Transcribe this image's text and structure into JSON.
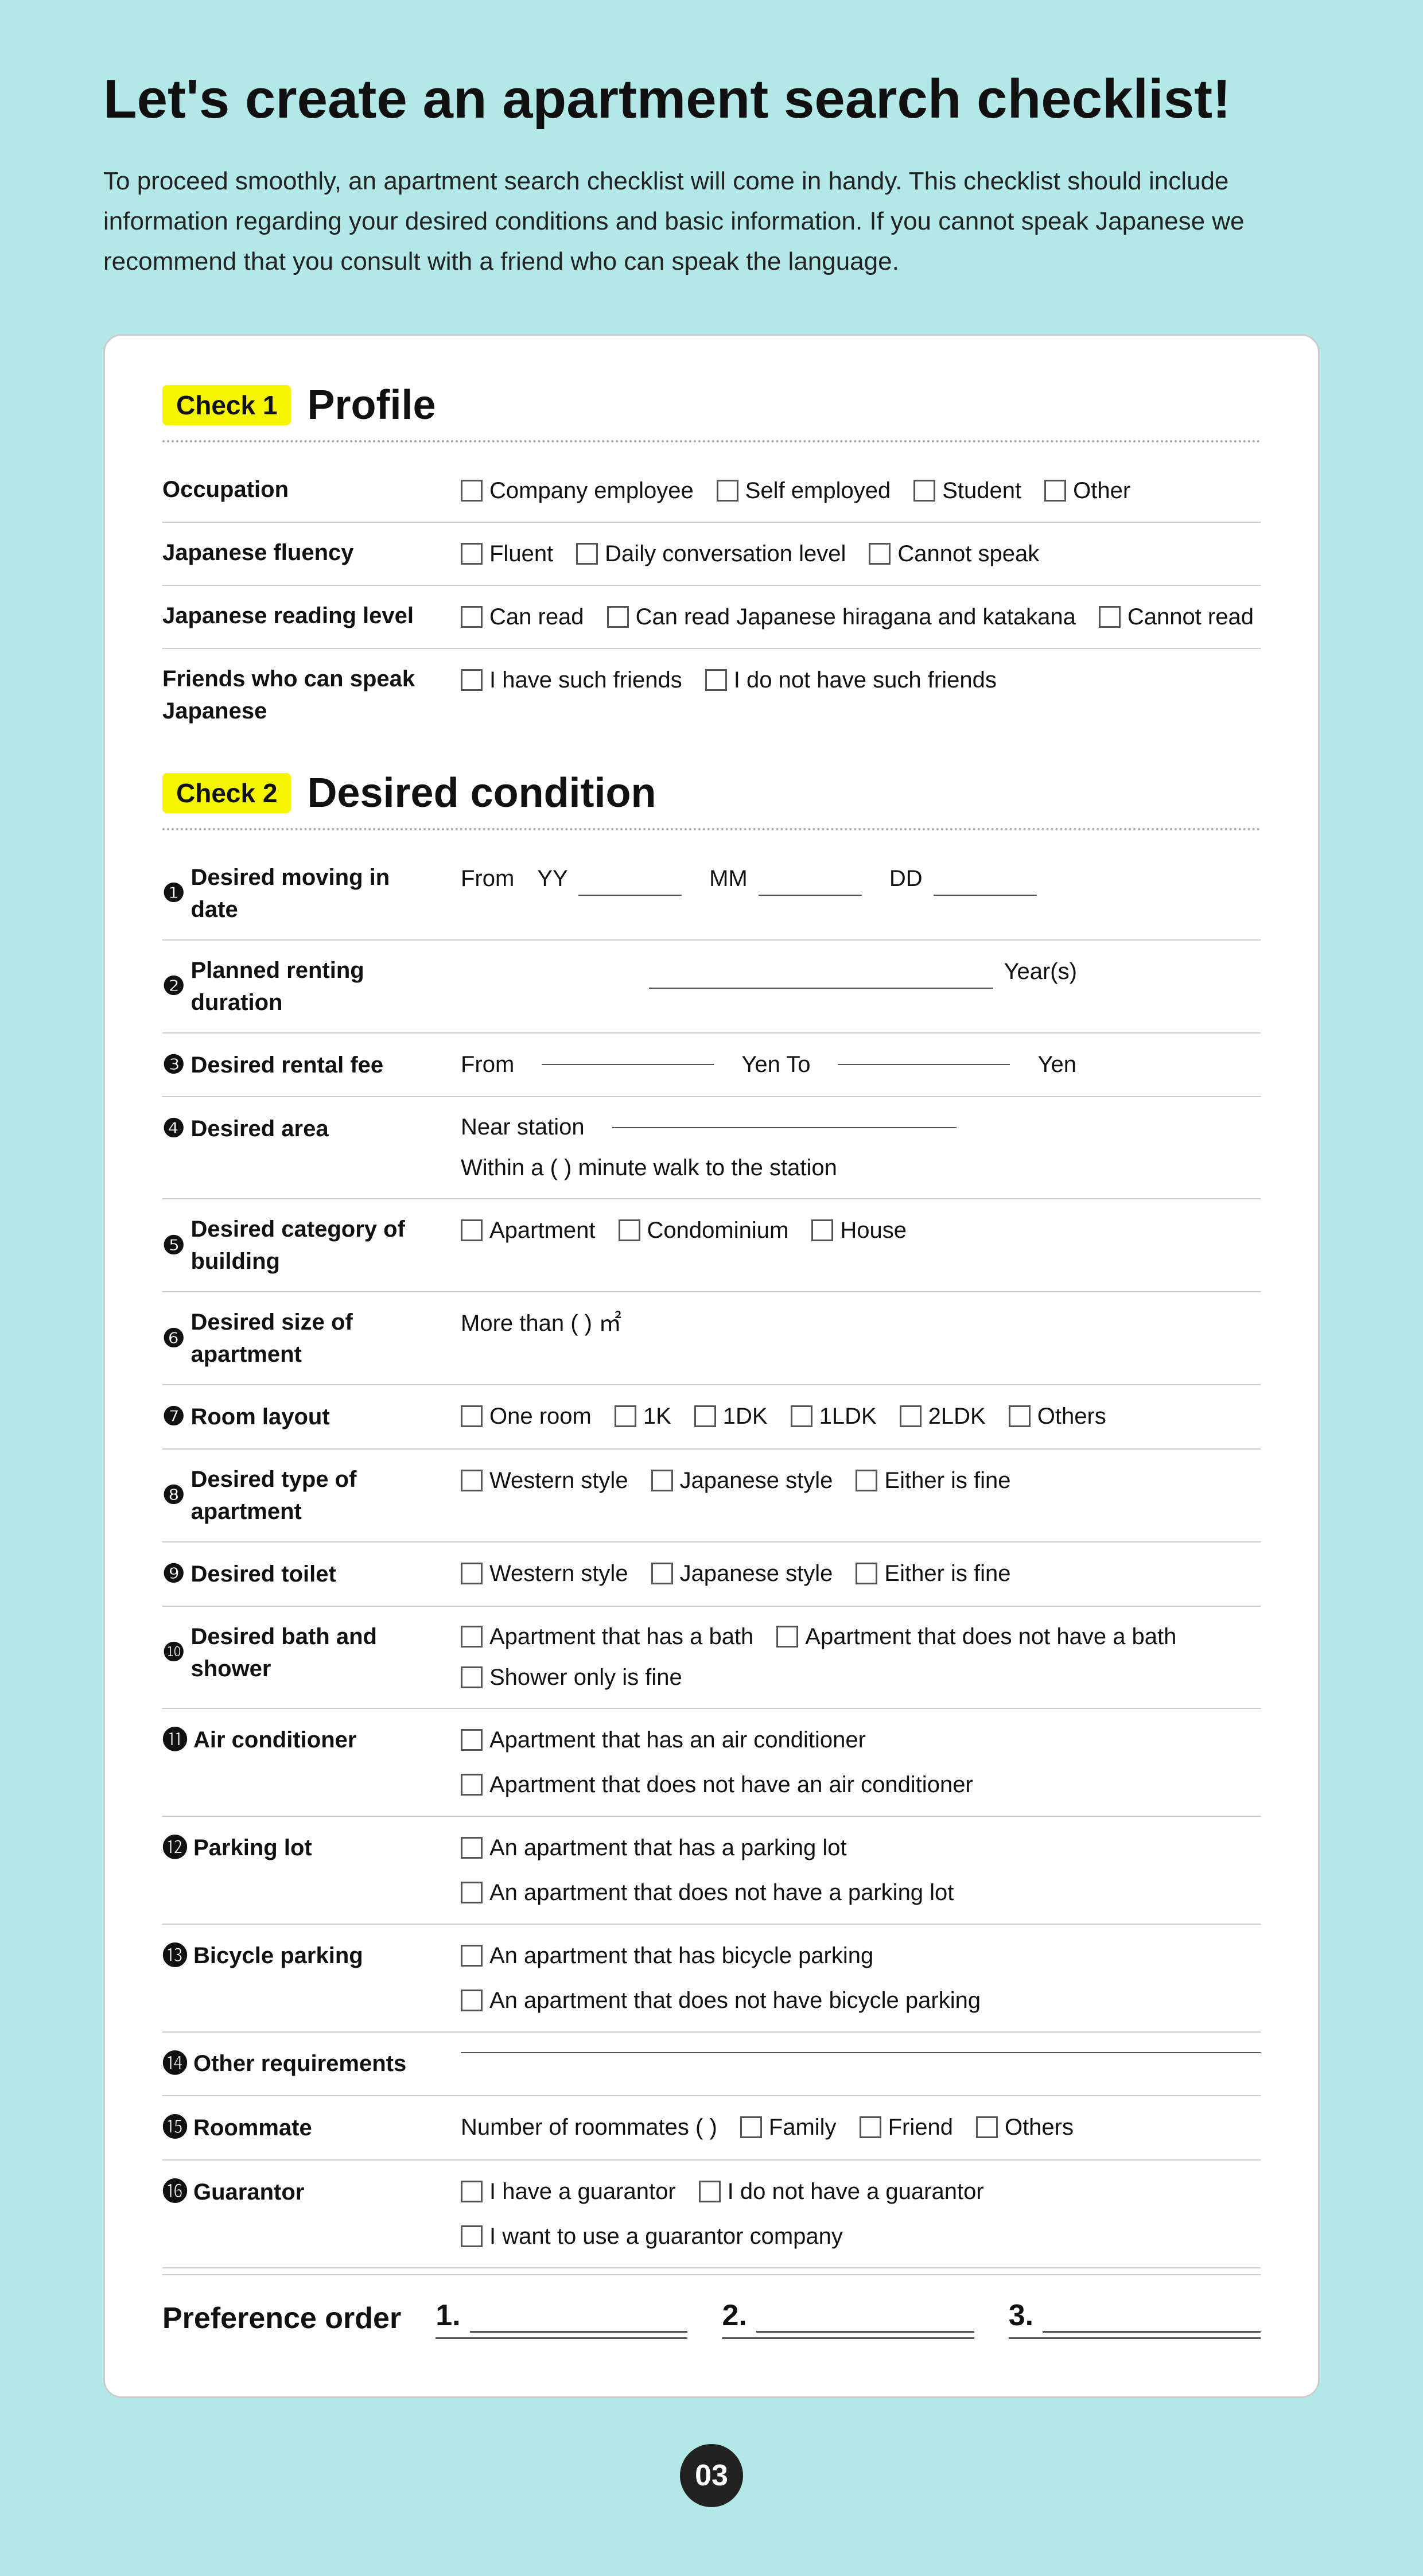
{
  "page": {
    "title": "Let's create an apartment search checklist!",
    "intro": "To proceed smoothly, an apartment search checklist will come in handy. This checklist should include information regarding your desired conditions and basic information. If you cannot speak Japanese we recommend that you consult with a friend who can speak the language.",
    "page_number": "03"
  },
  "check1": {
    "badge": "Check 1",
    "title": "Profile",
    "rows": [
      {
        "label": "Occupation",
        "options": [
          "Company employee",
          "Self employed",
          "Student",
          "Other"
        ]
      },
      {
        "label": "Japanese fluency",
        "options": [
          "Fluent",
          "Daily conversation level",
          "Cannot speak"
        ]
      },
      {
        "label": "Japanese reading level",
        "options": [
          "Can read",
          "Can read Japanese hiragana and katakana",
          "Cannot read"
        ]
      },
      {
        "label": "Friends who can speak Japanese",
        "options": [
          "I have such friends",
          "I do not have such friends"
        ]
      }
    ]
  },
  "check2": {
    "badge": "Check 2",
    "title": "Desired condition",
    "rows": [
      {
        "num": "❶",
        "label": "Desired moving in date",
        "type": "date",
        "prefix": "From",
        "fields": [
          "YY",
          "MM",
          "DD"
        ]
      },
      {
        "num": "❷",
        "label": "Planned renting duration",
        "type": "text",
        "content": "Year(s)"
      },
      {
        "num": "❸",
        "label": "Desired rental fee",
        "type": "range",
        "from": "From",
        "mid": "Yen  To",
        "to": "Yen"
      },
      {
        "num": "❹",
        "label": "Desired area",
        "type": "area",
        "line1": "Near station",
        "line2": "Within a (      ) minute walk to the station"
      },
      {
        "num": "❺",
        "label": "Desired category of building",
        "type": "checkboxes",
        "options": [
          "Apartment",
          "Condominium",
          "House"
        ]
      },
      {
        "num": "❻",
        "label": "Desired size of apartment",
        "type": "size",
        "content": "More than (       ) ㎡"
      },
      {
        "num": "❼",
        "label": "Room layout",
        "type": "checkboxes",
        "options": [
          "One room",
          "1K",
          "1DK",
          "1LDK",
          "2LDK",
          "Others"
        ]
      },
      {
        "num": "❽",
        "label": "Desired type of apartment",
        "type": "checkboxes",
        "options": [
          "Western style",
          "Japanese style",
          "Either is fine"
        ]
      },
      {
        "num": "❾",
        "label": "Desired toilet",
        "type": "checkboxes",
        "options": [
          "Western style",
          "Japanese style",
          "Either is fine"
        ]
      },
      {
        "num": "❿",
        "label": "Desired bath and shower",
        "type": "bath",
        "line1_options": [
          "Apartment that has a bath",
          "Apartment that does not have a bath"
        ],
        "line2_options": [
          "Shower only is fine"
        ]
      },
      {
        "num": "⓫",
        "label": "Air conditioner",
        "type": "checkboxes",
        "options": [
          "Apartment that has an air conditioner",
          "Apartment that does not have an air conditioner"
        ]
      },
      {
        "num": "⓬",
        "label": "Parking lot",
        "type": "checkboxes",
        "options": [
          "An apartment that has a parking lot",
          "An apartment that does not have a parking lot"
        ]
      },
      {
        "num": "⓭",
        "label": "Bicycle parking",
        "type": "checkboxes",
        "options": [
          "An apartment that has bicycle parking",
          "An apartment that does not have bicycle parking"
        ]
      },
      {
        "num": "⓮",
        "label": "Other requirements",
        "type": "blank"
      },
      {
        "num": "⓯",
        "label": "Roommate",
        "type": "roommate",
        "prefix": "Number of roommates  (        )",
        "options": [
          "Family",
          "Friend",
          "Others"
        ]
      },
      {
        "num": "⓰",
        "label": "Guarantor",
        "type": "checkboxes",
        "options": [
          "I have a guarantor",
          "I do not have a guarantor",
          "I want to use a guarantor company"
        ]
      }
    ]
  },
  "preference": {
    "label": "Preference order",
    "items": [
      "1.",
      "2.",
      "3."
    ]
  }
}
